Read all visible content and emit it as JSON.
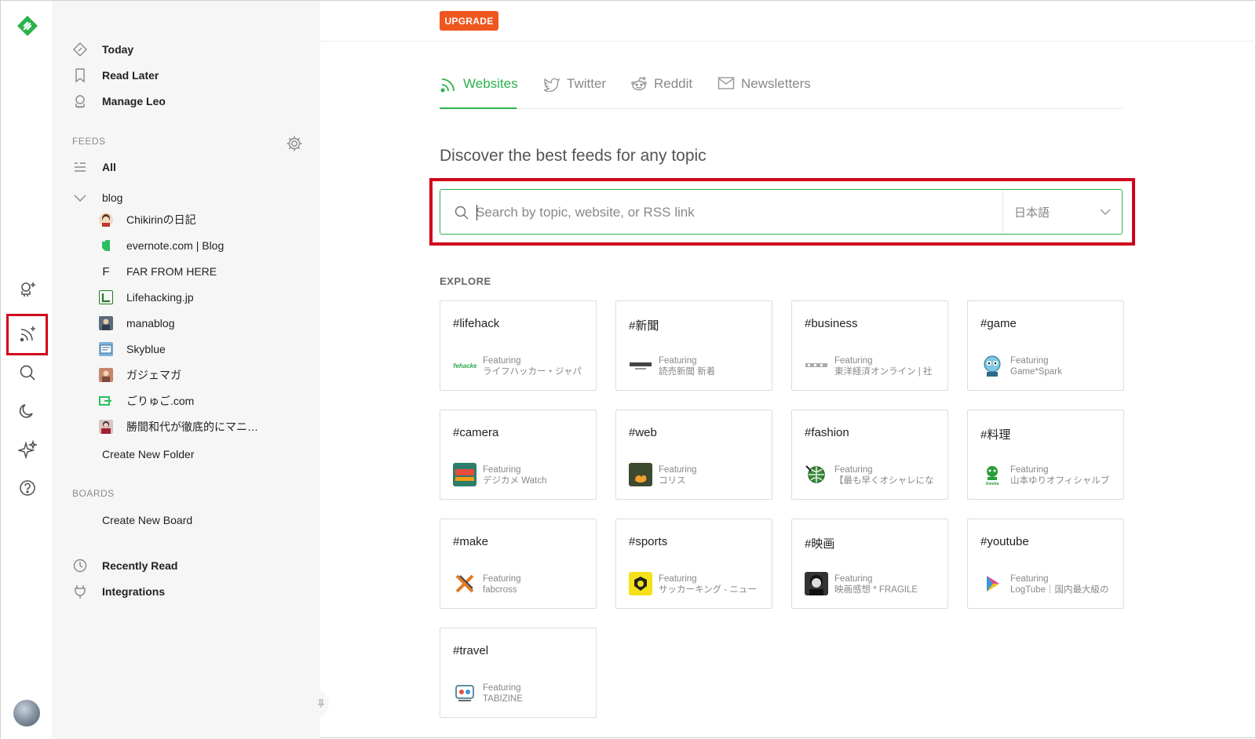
{
  "rail": {
    "accent": "#2bb24c",
    "icons": [
      "feedly-logo-icon",
      "add-source-icon",
      "add-feed-icon",
      "search-icon",
      "night-mode-icon",
      "sparkle-icon",
      "help-icon"
    ]
  },
  "nav": {
    "today": "Today",
    "read_later": "Read Later",
    "manage_leo": "Manage Leo"
  },
  "feeds": {
    "label": "FEEDS",
    "all": "All",
    "folder": "blog",
    "items": [
      {
        "label": "Chikirinの日記",
        "icon": "chikirin-avatar-icon"
      },
      {
        "label": "evernote.com | Blog",
        "icon": "evernote-icon"
      },
      {
        "label": "FAR FROM HERE",
        "icon": "letter-f-icon",
        "glyph": "F"
      },
      {
        "label": "Lifehacking.jp",
        "icon": "lifehacking-icon"
      },
      {
        "label": "manablog",
        "icon": "manablog-icon"
      },
      {
        "label": "Skyblue",
        "icon": "skyblue-icon"
      },
      {
        "label": "ガジェマガ",
        "icon": "gajemaga-icon"
      },
      {
        "label": "ごりゅご.com",
        "icon": "goryugo-icon"
      },
      {
        "label": "勝間和代が徹底的にマニ…",
        "icon": "katsuma-icon"
      }
    ],
    "create_folder": "Create New Folder"
  },
  "boards": {
    "label": "BOARDS",
    "create_board": "Create New Board"
  },
  "bottom_nav": {
    "recently_read": "Recently Read",
    "integrations": "Integrations"
  },
  "topbar": {
    "upgrade": "UPGRADE",
    "upgrade_color": "#f0571f"
  },
  "tabs": [
    {
      "label": "Websites",
      "icon": "rss-icon",
      "active": true
    },
    {
      "label": "Twitter",
      "icon": "twitter-icon",
      "active": false
    },
    {
      "label": "Reddit",
      "icon": "reddit-icon",
      "active": false
    },
    {
      "label": "Newsletters",
      "icon": "envelope-icon",
      "active": false
    }
  ],
  "discover": {
    "heading": "Discover the best feeds for any topic",
    "placeholder": "Search by topic, website, or RSS link",
    "language": "日本語"
  },
  "explore": {
    "label": "EXPLORE",
    "featuring": "Featuring",
    "cards": [
      {
        "tag": "#lifehack",
        "source": "ライフハッカー・ジャパ",
        "icon": "lifehacker-logo-icon"
      },
      {
        "tag": "#新聞",
        "source": "読売新聞 新着",
        "icon": "yomiuri-logo-icon"
      },
      {
        "tag": "#business",
        "source": "東洋経済オンライン | 社",
        "icon": "toyokeizai-logo-icon"
      },
      {
        "tag": "#game",
        "source": "Game*Spark",
        "icon": "gamespark-logo-icon"
      },
      {
        "tag": "#camera",
        "source": "デジカメ Watch",
        "icon": "dcwatch-logo-icon"
      },
      {
        "tag": "#web",
        "source": "コリス",
        "icon": "coliss-logo-icon"
      },
      {
        "tag": "#fashion",
        "source": "【最も早くオシャレにな",
        "icon": "fashion-globe-icon"
      },
      {
        "tag": "#料理",
        "source": "山本ゆりオフィシャルブ",
        "icon": "ameba-logo-icon"
      },
      {
        "tag": "#make",
        "source": "fabcross",
        "icon": "fabcross-logo-icon"
      },
      {
        "tag": "#sports",
        "source": "サッカーキング - ニュー",
        "icon": "soccerking-logo-icon"
      },
      {
        "tag": "#映画",
        "source": "映画感想 * FRAGILE",
        "icon": "fragile-avatar-icon"
      },
      {
        "tag": "#youtube",
        "source": "LogTube｜国内最大級の",
        "icon": "logtube-logo-icon"
      },
      {
        "tag": "#travel",
        "source": "TABIZINE",
        "icon": "tabizine-logo-icon"
      }
    ]
  },
  "highlight_color": "#d0021b"
}
